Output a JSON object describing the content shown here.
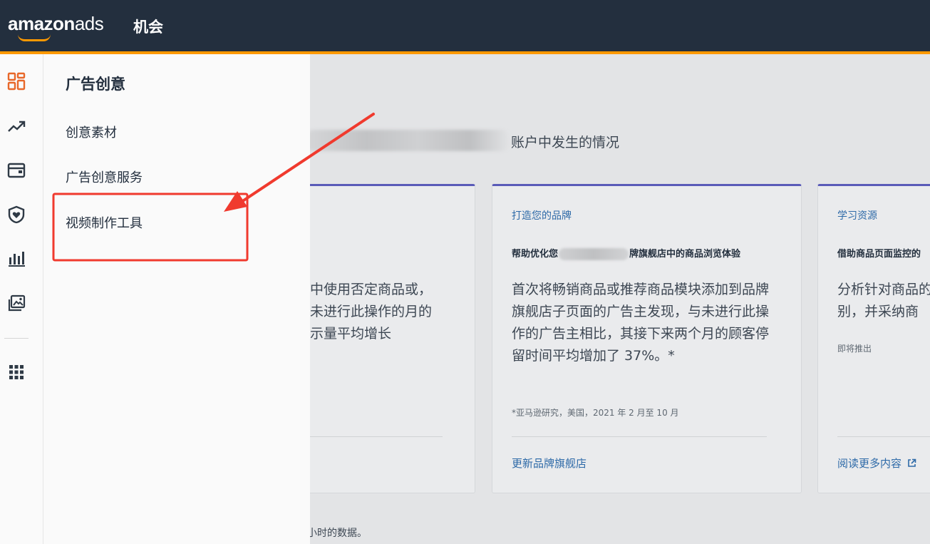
{
  "header": {
    "logo_main": "amazon",
    "logo_sub": "ads",
    "title": "机会"
  },
  "rail": {
    "icons": [
      "dashboard-icon",
      "trend-icon",
      "wallet-icon",
      "shield-heart-icon",
      "bar-chart-icon",
      "media-icon",
      "apps-grid-icon"
    ],
    "active_color": "#e8682a"
  },
  "flyout": {
    "title": "广告创意",
    "items": [
      {
        "label": "创意素材"
      },
      {
        "label": "广告创意服务"
      },
      {
        "label": "视频制作工具"
      }
    ]
  },
  "main": {
    "headline": "账户中发生的情况",
    "footnote": "小时的数据。",
    "cards": [
      {
        "body": "动中使用否定商品或，与未进行此操作的月的展示量平均增长"
      },
      {
        "kicker": "打造您的品牌",
        "subtitle_before": "帮助优化您",
        "subtitle_after": "牌旗舰店中的商品浏览体验",
        "body": "首次将畅销商品或推荐商品模块添加到品牌旗舰店子页面的广告主发现，与未进行此操作的广告主相比，其接下来两个月的顾客停留时间平均增加了 37%。*",
        "note": "*亚马逊研究，美国，2021 年 2 月至 10 月",
        "link": "更新品牌旗舰店"
      },
      {
        "kicker": "学习资源",
        "subtitle": "借助商品页面监控的",
        "body": "分析针对商品的别，并采纳商",
        "note": "即将推出",
        "link": "阅读更多内容"
      }
    ]
  },
  "colors": {
    "topbar": "#232f3e",
    "accent": "#ff9900",
    "card_top": "#5a5bb8",
    "link": "#2e6aa8",
    "annotation": "#f03a2e"
  }
}
